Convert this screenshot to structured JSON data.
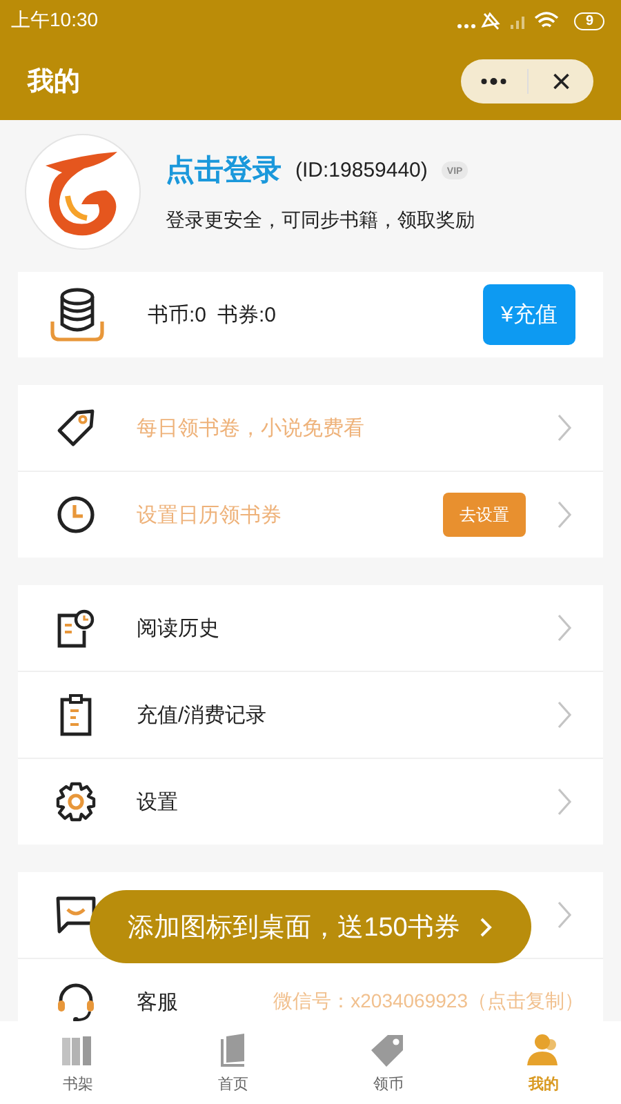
{
  "status_bar": {
    "time": "上午10:30",
    "battery": "9"
  },
  "header": {
    "title": "我的"
  },
  "profile": {
    "login": "点击登录",
    "id": "(ID:19859440)",
    "vip": "VIP",
    "subtitle": "登录更安全，可同步书籍，领取奖励"
  },
  "wallet": {
    "coins": "书币:0",
    "vouchers": "书券:0",
    "button": "¥充值"
  },
  "promo_rows": [
    {
      "kind": "tag",
      "label": "每日领书卷，小说免费看"
    },
    {
      "kind": "clock",
      "label": "设置日历领书券",
      "action": "去设置"
    }
  ],
  "menu_sections": [
    [
      {
        "kind": "history",
        "label": "阅读历史"
      },
      {
        "kind": "clipboard",
        "label": "充值/消费记录"
      },
      {
        "kind": "gear",
        "label": "设置"
      }
    ],
    [
      {
        "kind": "chat"
      },
      {
        "kind": "headset",
        "label": "客服",
        "detail": "微信号：x2034069923（点击复制）"
      }
    ]
  ],
  "toast": {
    "text": "添加图标到桌面，送150书券"
  },
  "tabs": [
    {
      "kind": "shelf",
      "label": "书架",
      "selected": false
    },
    {
      "kind": "book",
      "label": "首页",
      "selected": false
    },
    {
      "kind": "tag",
      "label": "领币",
      "selected": false
    },
    {
      "kind": "user",
      "label": "我的",
      "selected": true
    }
  ]
}
